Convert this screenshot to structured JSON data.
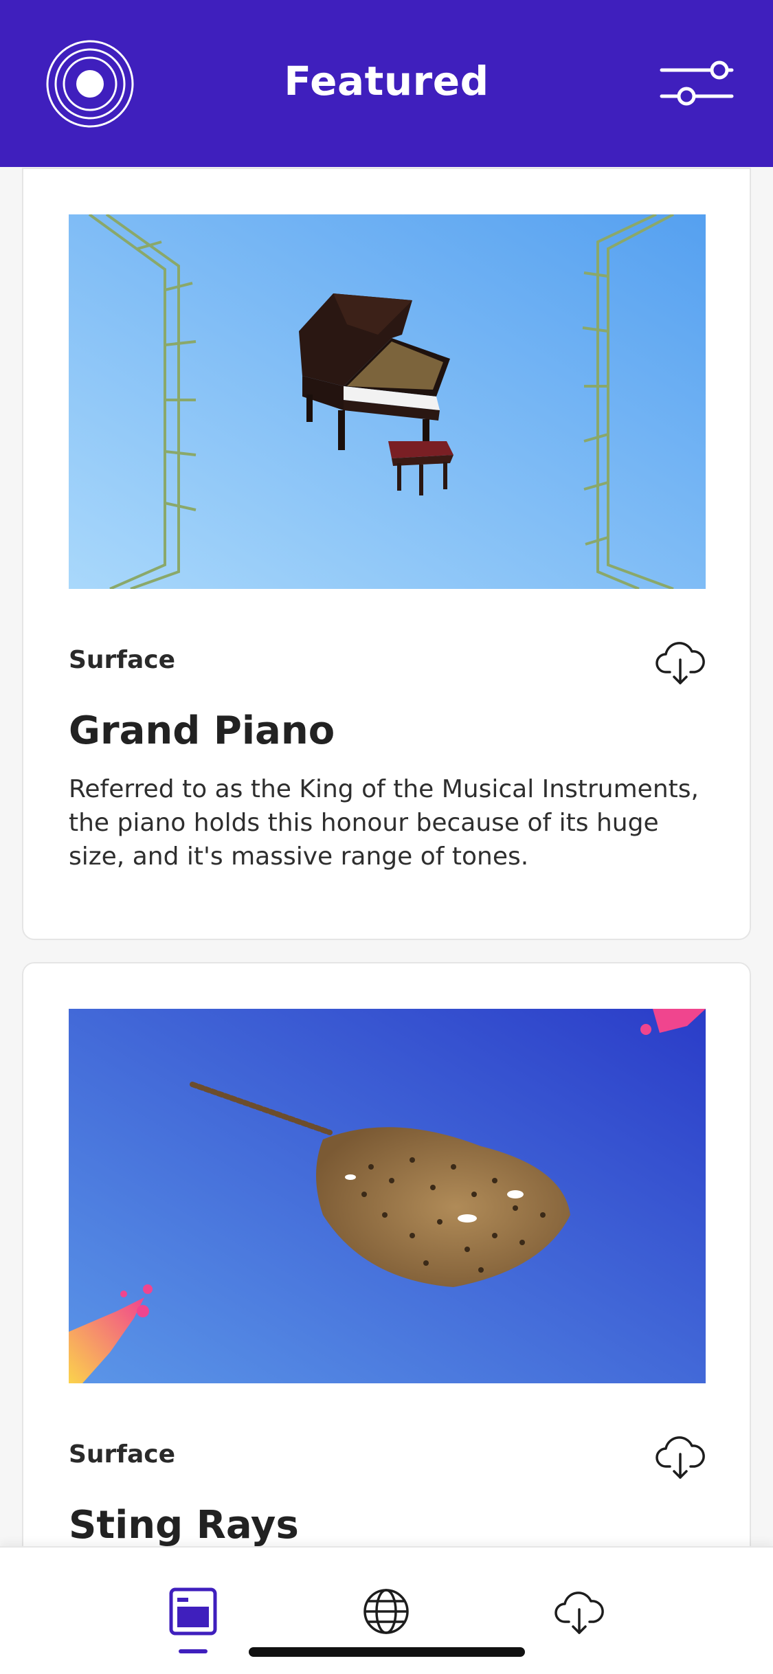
{
  "header": {
    "title": "Featured"
  },
  "cards": [
    {
      "category": "Surface",
      "title": "Grand Piano",
      "description": "Referred to as the King of the Musical Instruments, the piano holds this honour because of its huge size, and it's massive range of tones."
    },
    {
      "category": "Surface",
      "title": "Sting Rays"
    }
  ],
  "colors": {
    "brand": "#3f1fbd",
    "card_background": "#ffffff",
    "page_background": "#f6f6f6"
  },
  "icons": {
    "logo": "concentric-circles-icon",
    "filter": "sliders-icon",
    "download": "cloud-download-icon",
    "nav_featured": "featured-window-icon",
    "nav_explore": "globe-icon",
    "nav_downloads": "cloud-download-icon"
  },
  "bottom_nav": {
    "active": "featured"
  }
}
